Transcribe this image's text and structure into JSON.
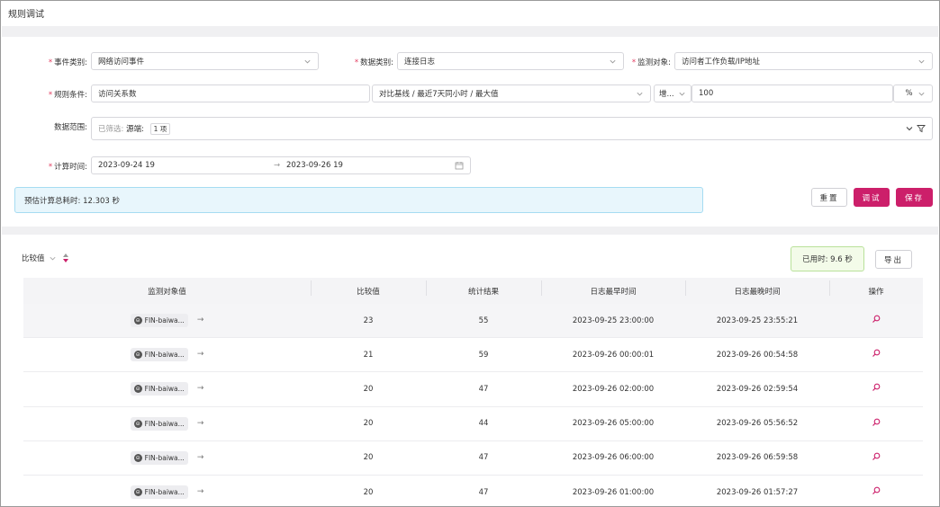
{
  "title": "规则调试",
  "form": {
    "event_type": {
      "label": "事件类别:",
      "value": "网络访问事件"
    },
    "data_type": {
      "label": "数据类别:",
      "value": "连接日志"
    },
    "monitor_obj": {
      "label": "监测对象:",
      "value": "访问者工作负载/IP地址"
    },
    "rule_cond": {
      "label": "规则条件:",
      "value": "访问关系数",
      "baseline": "对比基线 / 最近7天同小时 / 最大值",
      "op": "增...",
      "number": "100",
      "unit": "%"
    },
    "data_range": {
      "label": "数据范围:",
      "prefix": "已筛选:",
      "key": "源端:",
      "count": "1 项"
    },
    "calc_time": {
      "label": "计算时间:",
      "start": "2023-09-24 19",
      "sep": "→",
      "end": "2023-09-26 19"
    }
  },
  "estimate": "预估计算总耗时: 12.303 秒",
  "buttons": {
    "reset": "重置",
    "debug": "调试",
    "save": "保存"
  },
  "sort": {
    "label": "比较值"
  },
  "elapsed": "已用时: 9.6 秒",
  "export": "导出",
  "columns": [
    "监测对象值",
    "比较值",
    "统计结果",
    "日志最早时间",
    "日志最晚时间",
    "操作"
  ],
  "rows": [
    {
      "obj": "FIN-baiwa...",
      "cmp": "23",
      "stat": "55",
      "earliest": "2023-09-25 23:00:00",
      "latest": "2023-09-25 23:55:21"
    },
    {
      "obj": "FIN-baiwa...",
      "cmp": "21",
      "stat": "59",
      "earliest": "2023-09-26 00:00:01",
      "latest": "2023-09-26 00:54:58"
    },
    {
      "obj": "FIN-baiwa...",
      "cmp": "20",
      "stat": "47",
      "earliest": "2023-09-26 02:00:00",
      "latest": "2023-09-26 02:59:54"
    },
    {
      "obj": "FIN-baiwa...",
      "cmp": "20",
      "stat": "44",
      "earliest": "2023-09-26 05:00:00",
      "latest": "2023-09-26 05:56:52"
    },
    {
      "obj": "FIN-baiwa...",
      "cmp": "20",
      "stat": "47",
      "earliest": "2023-09-26 06:00:00",
      "latest": "2023-09-26 06:59:58"
    },
    {
      "obj": "FIN-baiwa...",
      "cmp": "20",
      "stat": "47",
      "earliest": "2023-09-26 01:00:00",
      "latest": "2023-09-26 01:57:27"
    }
  ],
  "colors": {
    "accent": "#cc1f6a",
    "info_bg": "#e8f6fc",
    "success_bg": "#f3fbe9"
  }
}
